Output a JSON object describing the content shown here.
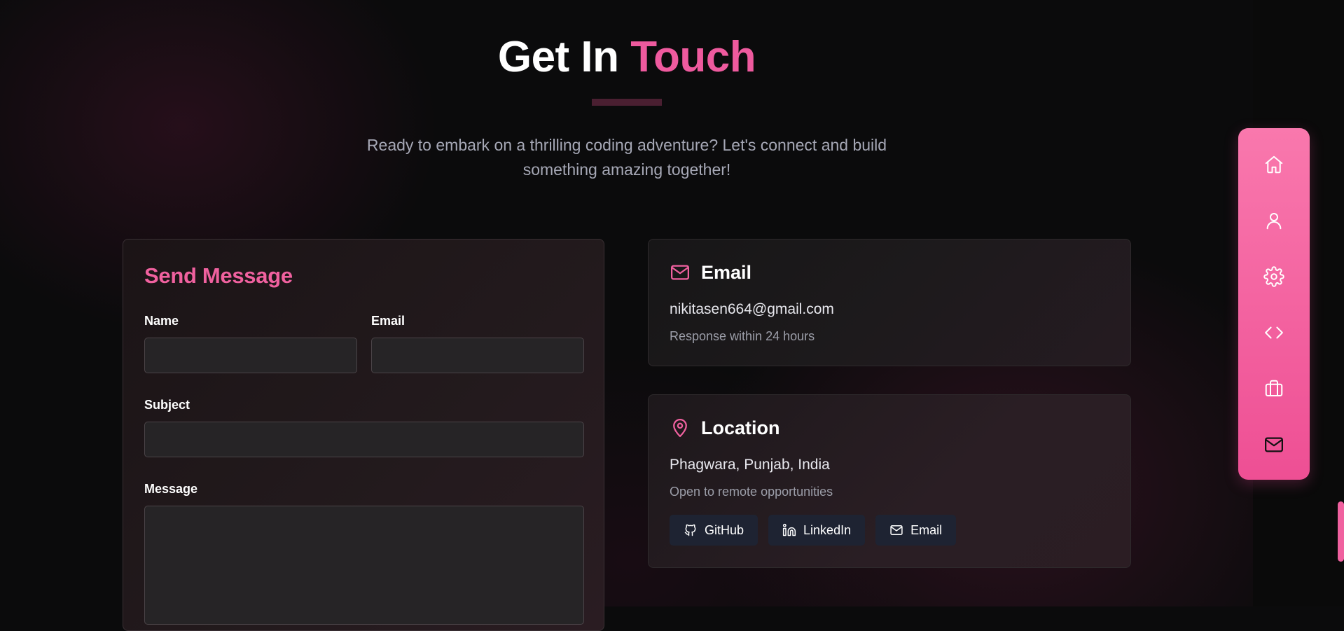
{
  "header": {
    "title_main": "Get In",
    "title_accent": "Touch",
    "subtitle_line1": "Ready to embark on a thrilling coding adventure? Let's connect and build",
    "subtitle_line2": "something amazing together!"
  },
  "form": {
    "title": "Send Message",
    "name_label": "Name",
    "name_value": "",
    "email_label": "Email",
    "email_value": "",
    "subject_label": "Subject",
    "subject_value": "",
    "message_label": "Message",
    "message_value": ""
  },
  "email_card": {
    "icon": "mail-icon",
    "title": "Email",
    "value": "nikitasen664@gmail.com",
    "note": "Response within 24 hours"
  },
  "location_card": {
    "icon": "map-pin-icon",
    "title": "Location",
    "value": "Phagwara, Punjab, India",
    "note": "Open to remote opportunities",
    "socials": [
      {
        "label": "GitHub",
        "icon": "github-icon"
      },
      {
        "label": "LinkedIn",
        "icon": "linkedin-icon"
      },
      {
        "label": "Email",
        "icon": "mail-icon"
      }
    ]
  },
  "side_nav": {
    "items": [
      {
        "icon": "home-icon"
      },
      {
        "icon": "user-icon"
      },
      {
        "icon": "gear-icon"
      },
      {
        "icon": "code-icon"
      },
      {
        "icon": "briefcase-icon"
      },
      {
        "icon": "mail-icon"
      }
    ]
  },
  "colors": {
    "accent": "#ee5a9e",
    "nav_gradient_top": "#f978ad",
    "nav_gradient_bottom": "#ee4f94",
    "background": "#0b0b0c",
    "social_button": "#1e2332"
  }
}
